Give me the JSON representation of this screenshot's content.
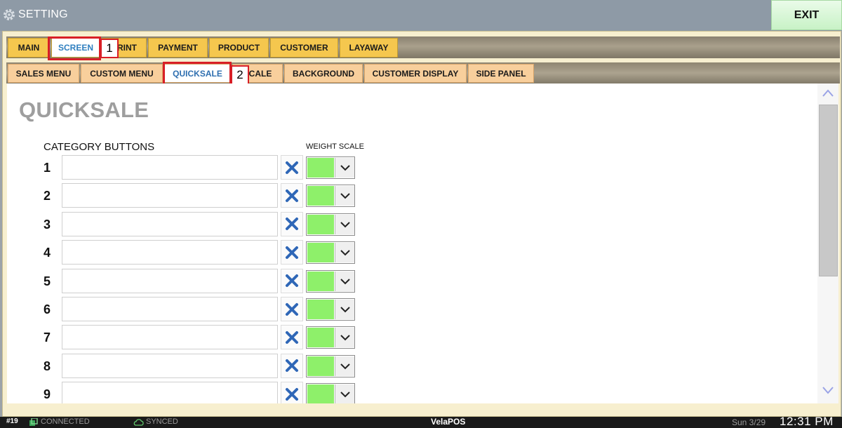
{
  "window": {
    "title": "SETTING",
    "exit_label": "EXIT"
  },
  "top_tabs": [
    {
      "label": "MAIN",
      "active": false
    },
    {
      "label": "SCREEN",
      "active": true
    },
    {
      "label": "PRINT",
      "active": false
    },
    {
      "label": "PAYMENT",
      "active": false
    },
    {
      "label": "PRODUCT",
      "active": false
    },
    {
      "label": "CUSTOMER",
      "active": false
    },
    {
      "label": "LAYAWAY",
      "active": false
    }
  ],
  "sub_tabs": [
    {
      "label": "SALES MENU",
      "active": false
    },
    {
      "label": "CUSTOM MENU",
      "active": false
    },
    {
      "label": "QUICKSALE",
      "active": true
    },
    {
      "label": "SCALE",
      "active": false
    },
    {
      "label": "BACKGROUND",
      "active": false
    },
    {
      "label": "CUSTOMER DISPLAY",
      "active": false
    },
    {
      "label": "SIDE PANEL",
      "active": false
    }
  ],
  "markers": {
    "one": "1",
    "two": "2"
  },
  "page": {
    "title": "QUICKSALE",
    "category_header": "CATEGORY BUTTONS",
    "weight_scale_header": "WEIGHT SCALE"
  },
  "category_rows": [
    {
      "number": "1",
      "value": ""
    },
    {
      "number": "2",
      "value": ""
    },
    {
      "number": "3",
      "value": ""
    },
    {
      "number": "4",
      "value": ""
    },
    {
      "number": "5",
      "value": ""
    },
    {
      "number": "6",
      "value": ""
    },
    {
      "number": "7",
      "value": ""
    },
    {
      "number": "8",
      "value": ""
    },
    {
      "number": "9",
      "value": ""
    }
  ],
  "colors": {
    "weight_scale_swatch": "#8ef06a",
    "clear_icon": "#2f67b7",
    "tab_active_text": "#2f7fc0",
    "marker_red": "#d81f26"
  },
  "status_bar": {
    "station": "#19",
    "connection": "CONNECTED",
    "sync": "SYNCED",
    "brand": "VelaPOS",
    "date": "Sun 3/29",
    "time": "12:31 PM"
  }
}
